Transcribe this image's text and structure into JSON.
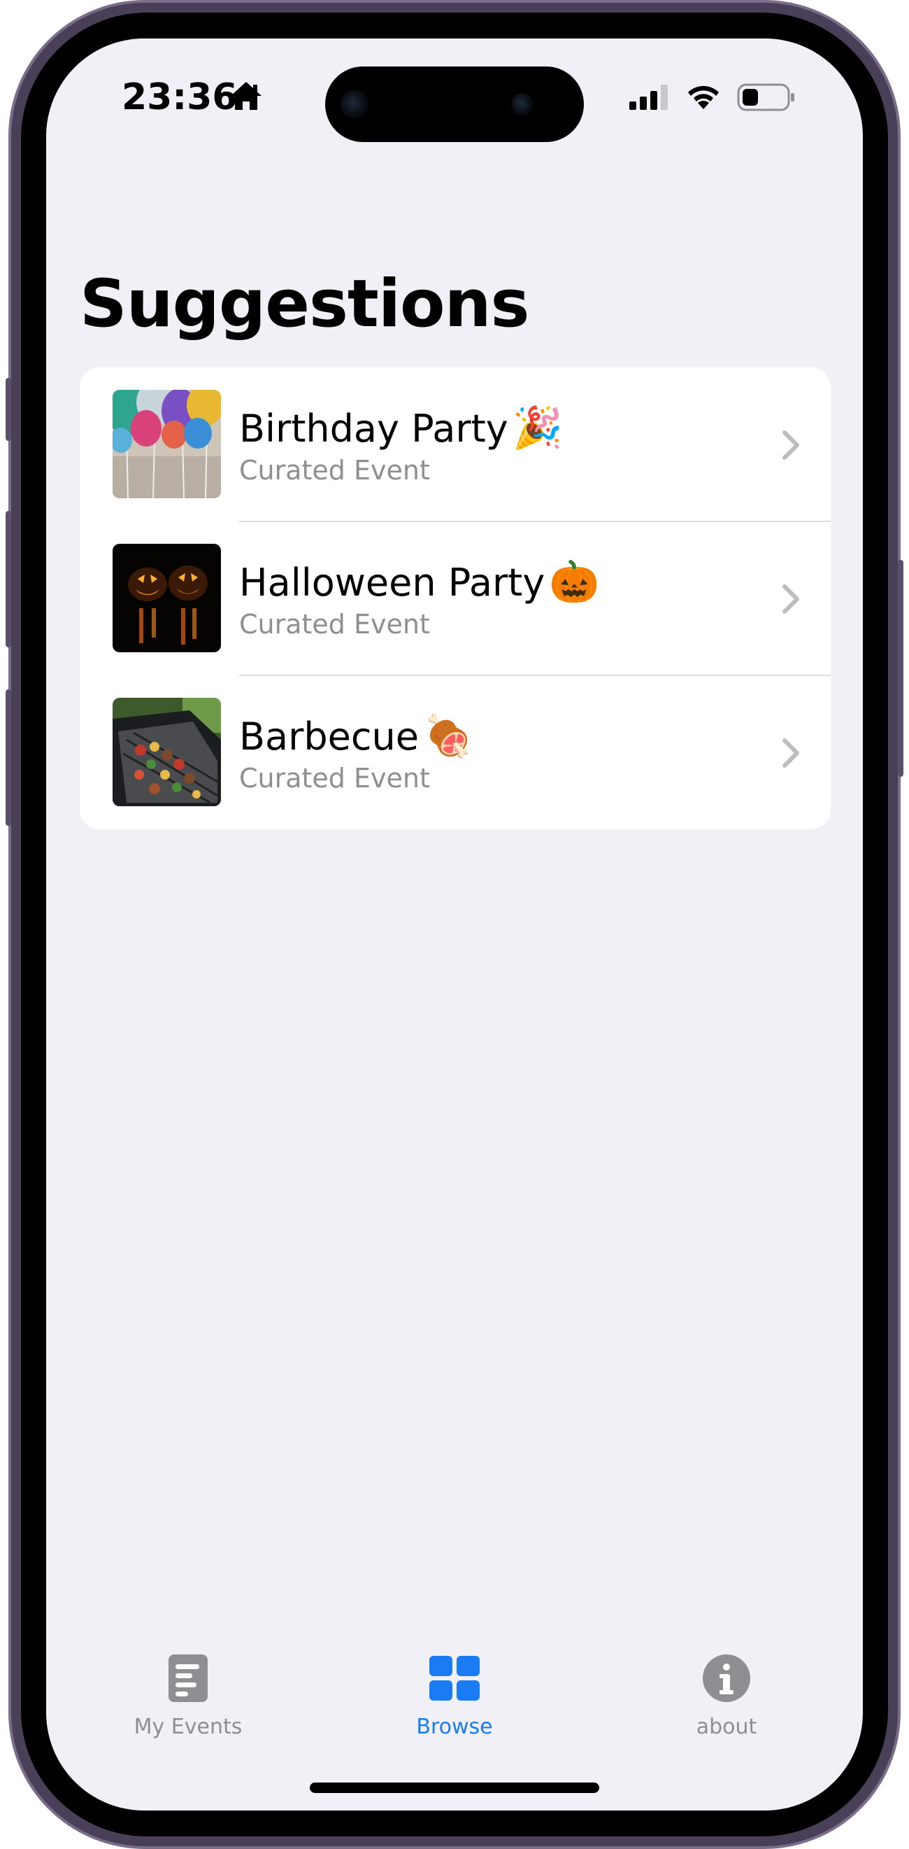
{
  "status_bar": {
    "time": "23:36",
    "home_icon": "house-icon",
    "signal_icon": "cellular-signal-icon",
    "wifi_icon": "wifi-icon",
    "battery_icon": "battery-icon"
  },
  "page": {
    "title": "Suggestions"
  },
  "suggestions": [
    {
      "title": "Birthday Party",
      "emoji": "🎉",
      "subtitle": "Curated Event",
      "image": "balloons-photo"
    },
    {
      "title": "Halloween Party",
      "emoji": "🎃",
      "subtitle": "Curated Event",
      "image": "jack-o-lanterns-photo"
    },
    {
      "title": "Barbecue",
      "emoji": "🍖",
      "subtitle": "Curated Event",
      "image": "grill-photo"
    }
  ],
  "tab_bar": {
    "tabs": [
      {
        "label": "My Events",
        "icon": "document-icon",
        "active": false
      },
      {
        "label": "Browse",
        "icon": "grid-icon",
        "active": true
      },
      {
        "label": "about",
        "icon": "info-icon",
        "active": false
      }
    ]
  },
  "colors": {
    "accent": "#1a7cf2",
    "background": "#f1f0f6",
    "card": "#ffffff",
    "secondary_text": "#8e8e93",
    "inactive_icon": "#8e8e93"
  }
}
